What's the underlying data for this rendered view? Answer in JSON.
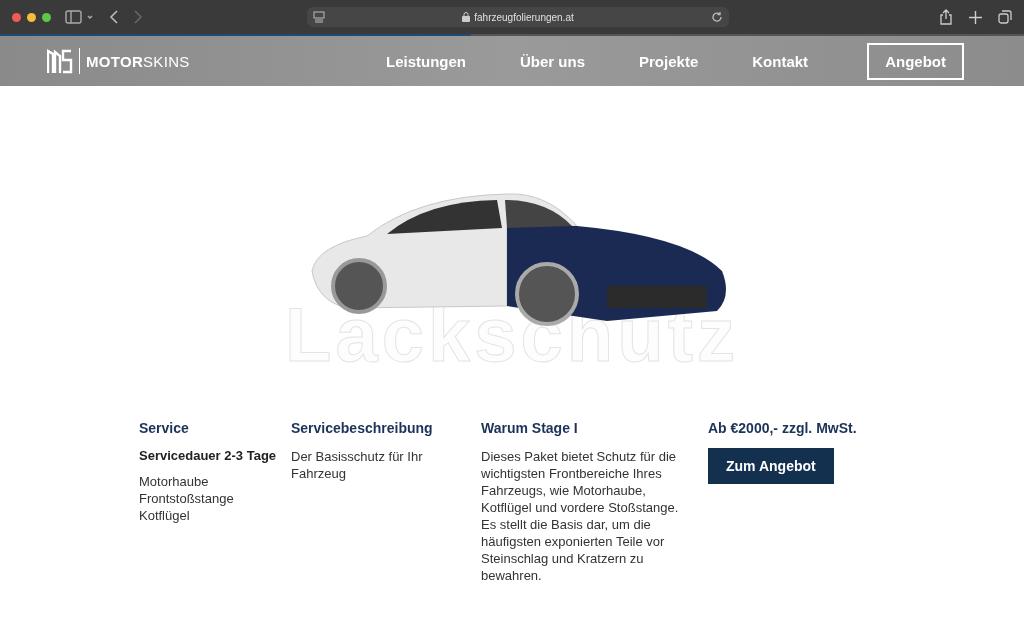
{
  "browser": {
    "url": "fahrzeugfolierungen.at",
    "level": 0.46
  },
  "nav": {
    "logo_bold": "MOTOR",
    "logo_light": "SKINS",
    "links": [
      {
        "label": "Leistungen"
      },
      {
        "label": "Über uns"
      },
      {
        "label": "Projekte"
      },
      {
        "label": "Kontakt"
      }
    ],
    "cta": "Angebot"
  },
  "hero": {
    "title": "Lackschutz"
  },
  "columns": [
    {
      "heading": "Service",
      "strong": "Servicedauer 2-3 Tage",
      "lines": [
        "Motorhaube",
        "Frontstoßstange",
        "Kotflügel"
      ]
    },
    {
      "heading": "Servicebeschreibung",
      "text": "Der Basisschutz für Ihr Fahrzeug"
    },
    {
      "heading": "Warum Stage I",
      "text": "Dieses Paket bietet Schutz für die wichtigsten Frontbereiche Ihres Fahrzeugs, wie Motorhaube, Kotflügel und vordere Stoßstange. Es stellt die Basis dar, um die häufigsten exponierten Teile vor Steinschlag und Kratzern zu bewahren."
    },
    {
      "heading": "Ab €2000,- zzgl. MwSt.",
      "button": "Zum Angebot"
    }
  ]
}
